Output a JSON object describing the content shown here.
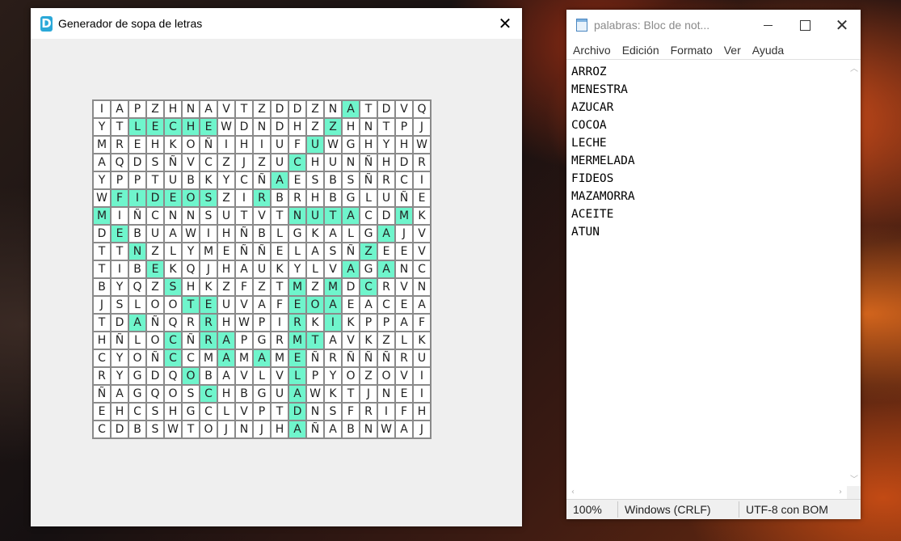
{
  "generator": {
    "title": "Generador de sopa de letras",
    "icon_letter": "D",
    "close_symbol": "✕",
    "highlight_color": "#6ff5cc",
    "rows": [
      "IAPZHNAVTZDDZNATDVQ",
      "YTLECHEWDNDHZZHNTPJ",
      "MREHKOÑIHIUFUWGHYHW",
      "AQDSÑVCZJZUCHUNÑHDR",
      "YPPTUBKYCÑAESBSÑRCI",
      "WFIDEOSZIRBRHBGLUÑE",
      "MIÑCNNSUTVTNUTACDMK",
      "DEBUAWIHÑBLGKALGAJV",
      "TTNZLYMEÑÑELASÑZEEV",
      "TIBEKQJHAUKYLVAGANC",
      "BYQZSHKZFZTMZMDCRVN",
      "JSLOOTEUVAFEOAEACEA",
      "TDAÑQRRHWPIRKIKPPAF",
      "HÑLOCÑRAPGRMTAVKZLK",
      "CYOÑCCMAMAMEÑRÑÑÑRU",
      "RYGDQOBAVLVLPYOZOVI",
      "ÑAGQOSCHBGUAWKTJNEI",
      "EHCSHGCLVPTDNSFRIFH",
      "CDBSWTOJNJHAÑABNWAJ"
    ],
    "highlights": [
      [
        0,
        14
      ],
      [
        1,
        2
      ],
      [
        1,
        3
      ],
      [
        1,
        4
      ],
      [
        1,
        5
      ],
      [
        1,
        6
      ],
      [
        1,
        13
      ],
      [
        2,
        12
      ],
      [
        3,
        11
      ],
      [
        4,
        10
      ],
      [
        5,
        1
      ],
      [
        5,
        2
      ],
      [
        5,
        3
      ],
      [
        5,
        4
      ],
      [
        5,
        5
      ],
      [
        5,
        6
      ],
      [
        5,
        9
      ],
      [
        6,
        0
      ],
      [
        6,
        11
      ],
      [
        6,
        12
      ],
      [
        6,
        13
      ],
      [
        6,
        14
      ],
      [
        6,
        17
      ],
      [
        7,
        1
      ],
      [
        7,
        16
      ],
      [
        8,
        2
      ],
      [
        8,
        15
      ],
      [
        9,
        3
      ],
      [
        9,
        14
      ],
      [
        9,
        16
      ],
      [
        10,
        4
      ],
      [
        10,
        11
      ],
      [
        10,
        13
      ],
      [
        10,
        15
      ],
      [
        11,
        5
      ],
      [
        11,
        6
      ],
      [
        11,
        11
      ],
      [
        11,
        12
      ],
      [
        11,
        13
      ],
      [
        12,
        2
      ],
      [
        12,
        6
      ],
      [
        12,
        11
      ],
      [
        12,
        13
      ],
      [
        13,
        4
      ],
      [
        13,
        6
      ],
      [
        13,
        7
      ],
      [
        13,
        11
      ],
      [
        13,
        12
      ],
      [
        14,
        4
      ],
      [
        14,
        7
      ],
      [
        14,
        9
      ],
      [
        14,
        11
      ],
      [
        15,
        5
      ],
      [
        15,
        11
      ],
      [
        16,
        6
      ],
      [
        16,
        11
      ],
      [
        17,
        11
      ],
      [
        18,
        11
      ]
    ]
  },
  "notepad": {
    "title": "palabras: Bloc de not...",
    "menu": [
      "Archivo",
      "Edición",
      "Formato",
      "Ver",
      "Ayuda"
    ],
    "lines": [
      "ARROZ",
      "MENESTRA",
      "AZUCAR",
      "COCOA",
      "LECHE",
      "MERMELADA",
      "FIDEOS",
      "MAZAMORRA",
      "ACEITE",
      "ATUN"
    ],
    "status": {
      "zoom": "100%",
      "line_ending": "Windows (CRLF)",
      "encoding": "UTF-8 con BOM"
    }
  }
}
